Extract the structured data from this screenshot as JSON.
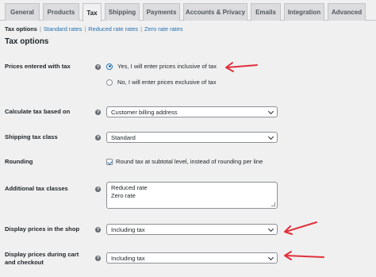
{
  "tabs": [
    {
      "label": "General"
    },
    {
      "label": "Products"
    },
    {
      "label": "Tax"
    },
    {
      "label": "Shipping"
    },
    {
      "label": "Payments"
    },
    {
      "label": "Accounts & Privacy"
    },
    {
      "label": "Emails"
    },
    {
      "label": "Integration"
    },
    {
      "label": "Advanced"
    }
  ],
  "subnav": {
    "current": "Tax options",
    "links": [
      "Standard rates",
      "Reduced rate rates",
      "Zero rate rates"
    ],
    "separator": "|"
  },
  "section_title": "Tax options",
  "help_glyph": "?",
  "settings": {
    "prices_entered_with_tax": {
      "label": "Prices entered with tax",
      "options": [
        {
          "label": "Yes, I will enter prices inclusive of tax",
          "checked": true
        },
        {
          "label": "No, I will enter prices exclusive of tax",
          "checked": false
        }
      ]
    },
    "calculate_tax_based_on": {
      "label": "Calculate tax based on",
      "value": "Customer billing address"
    },
    "shipping_tax_class": {
      "label": "Shipping tax class",
      "value": "Standard"
    },
    "rounding": {
      "label": "Rounding",
      "checkbox_label": "Round tax at subtotal level, instead of rounding per line",
      "checked": true
    },
    "additional_tax_classes": {
      "label": "Additional tax classes",
      "lines": [
        "Reduced rate",
        "Zero rate"
      ]
    },
    "display_prices_in_shop": {
      "label": "Display prices in the shop",
      "value": "Including tax"
    },
    "display_prices_cart": {
      "label_line1": "Display prices during cart",
      "label_line2": "and checkout",
      "value": "Including tax"
    }
  },
  "colors": {
    "arrow": "#e0303a",
    "link": "#2271b1",
    "accent": "#2271b1"
  }
}
